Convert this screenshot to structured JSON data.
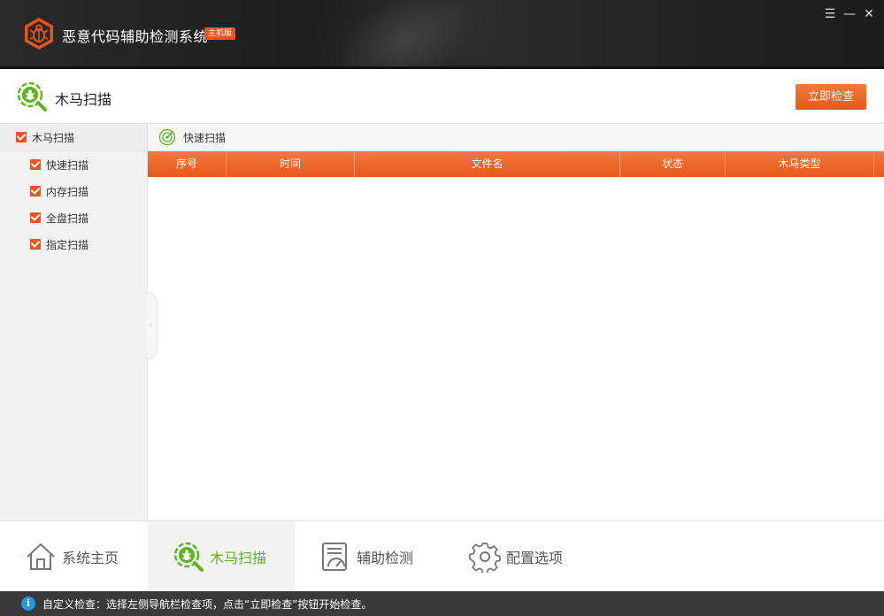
{
  "window": {
    "title": "恶意代码辅助检测系统",
    "edition_badge": "主机版",
    "menu_glyph": "☰",
    "minimize_glyph": "—",
    "close_glyph": "✕",
    "logo_icon": "bug-hexagon-icon",
    "accent_color": "#e8541c"
  },
  "header": {
    "title": "木马扫描",
    "icon": "bug-magnifier-icon",
    "scan_now_label": "立即检查"
  },
  "sidebar": {
    "root": {
      "label": "木马扫描",
      "checked": true
    },
    "items": [
      {
        "label": "快速扫描",
        "checked": true
      },
      {
        "label": "内存扫描",
        "checked": true
      },
      {
        "label": "全盘扫描",
        "checked": true
      },
      {
        "label": "指定扫描",
        "checked": true
      }
    ],
    "collapse_glyph": "‹"
  },
  "main": {
    "subheader_label": "快速扫描",
    "subheader_icon": "radar-icon",
    "columns": [
      "序号",
      "时间",
      "文件名",
      "状态",
      "木马类型"
    ],
    "rows": []
  },
  "bottom_nav": {
    "items": [
      {
        "label": "系统主页",
        "icon": "home-icon",
        "active": false
      },
      {
        "label": "木马扫描",
        "icon": "bug-magnifier-icon",
        "active": true
      },
      {
        "label": "辅助检测",
        "icon": "report-gauge-icon",
        "active": false
      },
      {
        "label": "配置选项",
        "icon": "gear-icon",
        "active": false
      }
    ],
    "active_color": "#5fb41e"
  },
  "status": {
    "info_glyph": "i",
    "text": "自定义检查：选择左侧导航栏检查项，点击“立即检查”按钮开始检查。"
  }
}
